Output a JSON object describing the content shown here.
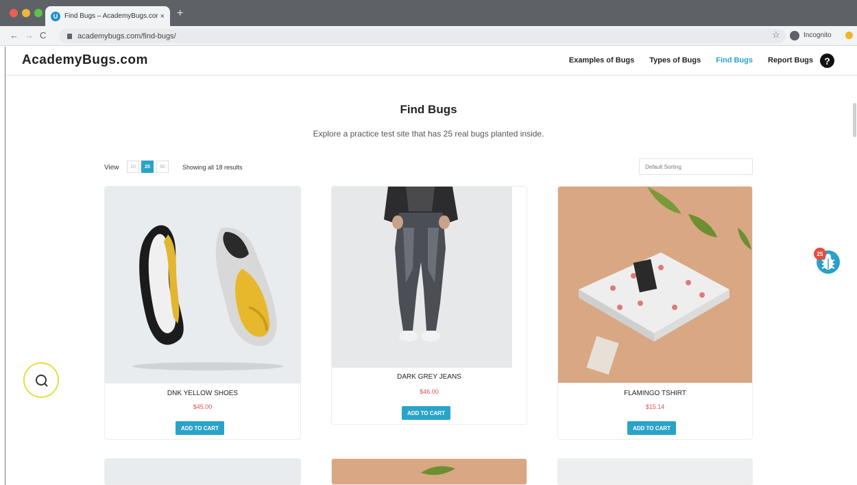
{
  "browser": {
    "tab_title": "Find Bugs – AcademyBugs.com",
    "tab_close": "×",
    "new_tab": "+",
    "url": "academybugs.com/find-bugs/",
    "incognito_label": "Incognito",
    "favicon_letter": "U"
  },
  "header": {
    "logo": "AcademyBugs.com",
    "nav": {
      "examples": "Examples of Bugs",
      "types": "Types of Bugs",
      "find": "Find Bugs",
      "report": "Report Bugs"
    },
    "help_glyph": "?"
  },
  "page": {
    "title": "Find Bugs",
    "subtitle": "Explore a practice test site that has 25 real bugs planted inside."
  },
  "toolbar": {
    "view_label": "View",
    "view_options": [
      "10",
      "25",
      "50"
    ],
    "selected_view": "25",
    "showing": "Showing all 18 results",
    "sort_value": "Default Sorting"
  },
  "products": [
    {
      "name": "DNK YELLOW SHOES",
      "price": "$45.00",
      "button": "ADD TO CART"
    },
    {
      "name": "DARK GREY JEANS",
      "price": "$46.00",
      "button": "ADD TO CART"
    },
    {
      "name": "FLAMINGO TSHIRT",
      "price": "$15.14",
      "button": "ADD TO CART"
    }
  ],
  "bug_widget": {
    "count": "25"
  },
  "icons": {
    "help": "question-circle-icon",
    "bug": "bug-icon",
    "lock": "lock-icon",
    "star": "star-icon",
    "incognito": "incognito-icon"
  },
  "colors": {
    "accent": "#29a2cf",
    "price": "#d9534f",
    "badge": "#e84b3c"
  }
}
